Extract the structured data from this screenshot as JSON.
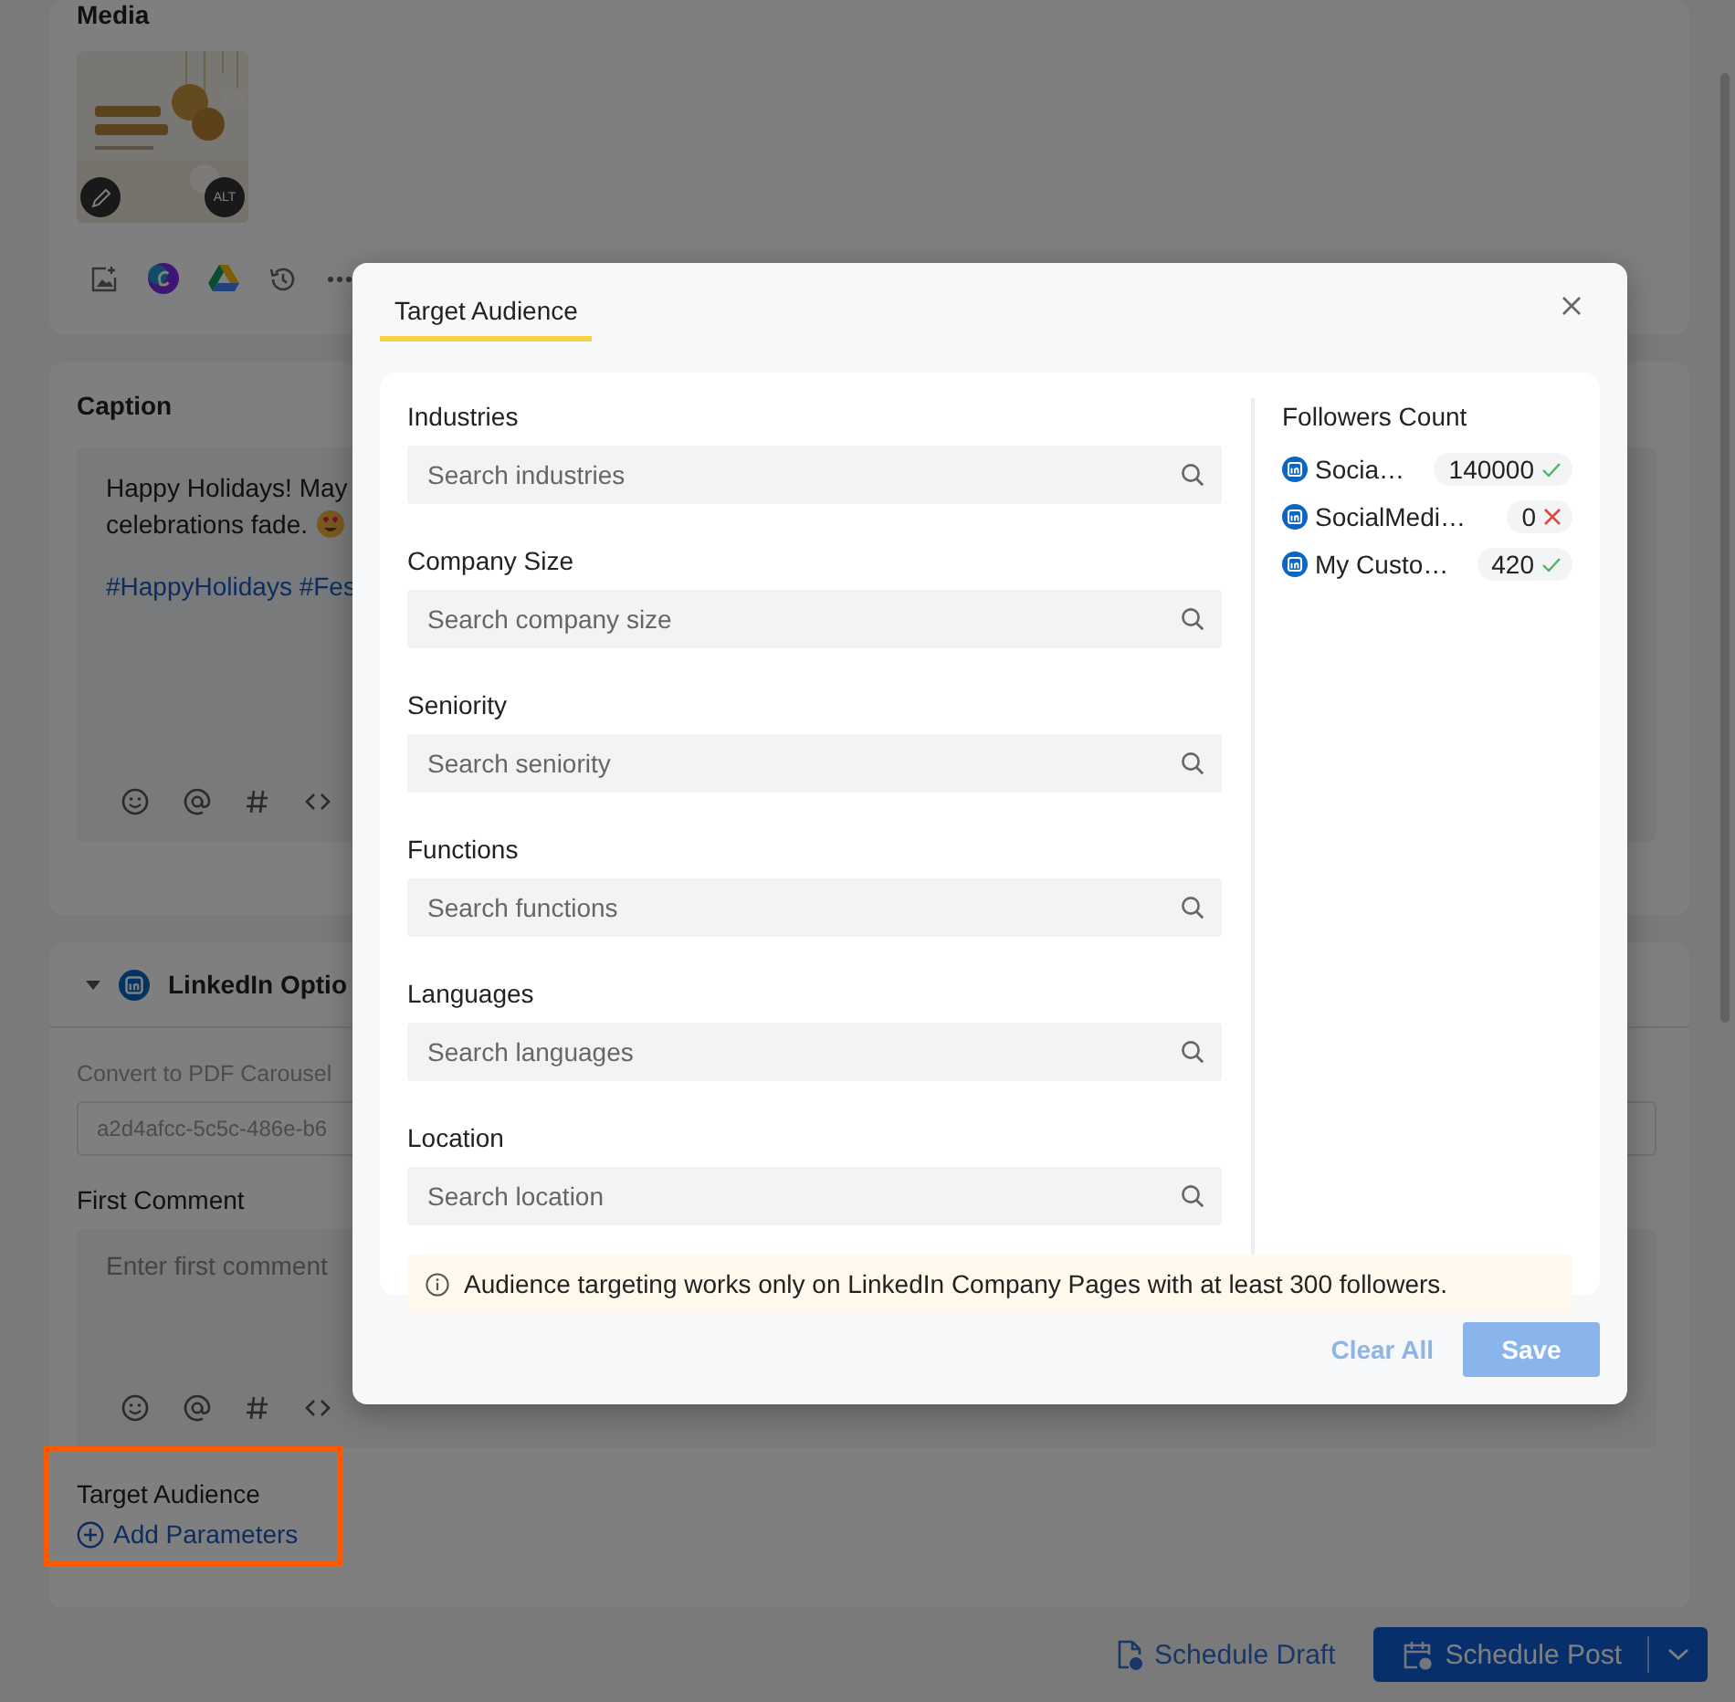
{
  "background": {
    "media": {
      "title": "Media",
      "alt_badge": "ALT"
    },
    "caption": {
      "title": "Caption",
      "lines": [
        "Happy Holidays! May",
        "celebrations fade."
      ],
      "hashtags": "#HappyHolidays #Fes"
    },
    "linkedin_options": {
      "title": "LinkedIn Optio",
      "convert_label": "Convert to PDF Carousel",
      "convert_value": "a2d4afcc-5c5c-486e-b6",
      "first_comment_label": "First Comment",
      "first_comment_placeholder": "Enter first comment",
      "target_audience_label": "Target Audience",
      "add_parameters": "Add Parameters"
    },
    "footer": {
      "schedule_draft": "Schedule Draft",
      "schedule_post": "Schedule Post"
    }
  },
  "dialog": {
    "tabs": [
      {
        "label": "Target Audience",
        "selected": true
      }
    ],
    "fields": [
      {
        "label": "Industries",
        "placeholder": "Search industries"
      },
      {
        "label": "Company Size",
        "placeholder": "Search company size"
      },
      {
        "label": "Seniority",
        "placeholder": "Search seniority"
      },
      {
        "label": "Functions",
        "placeholder": "Search functions"
      },
      {
        "label": "Languages",
        "placeholder": "Search languages"
      },
      {
        "label": "Location",
        "placeholder": "Search location"
      }
    ],
    "followers": {
      "title": "Followers Count",
      "accounts": [
        {
          "name": "Socia…",
          "count": "140000",
          "eligible": true
        },
        {
          "name": "SocialMedi…",
          "count": "0",
          "eligible": false
        },
        {
          "name": "My Custo…",
          "count": "420",
          "eligible": true
        }
      ]
    },
    "notice": "Audience targeting works only on LinkedIn Company Pages with at least 300 followers.",
    "buttons": [
      {
        "label": "Clear All",
        "kind": "link",
        "disabled": true
      },
      {
        "label": "Save",
        "kind": "primary",
        "disabled": true
      }
    ]
  }
}
